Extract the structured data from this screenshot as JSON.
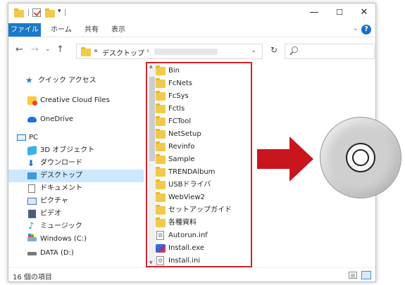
{
  "ribbon": {
    "tabs": [
      "ファイル",
      "ホーム",
      "共有",
      "表示"
    ],
    "help_glyph": "?"
  },
  "address": {
    "prefix": "«",
    "path_segment": "デスクトップ",
    "separator": "›",
    "search_placeholder": ""
  },
  "window_controls": {
    "minimize": "—",
    "maximize": "☐",
    "close": "✕"
  },
  "nav": [
    {
      "label": "クイック アクセス",
      "icon": "star-icon"
    },
    {
      "label": "Creative Cloud Files",
      "icon": "creative-cloud-icon"
    },
    {
      "label": "OneDrive",
      "icon": "cloud-icon"
    },
    {
      "label": "PC",
      "icon": "pc-icon"
    },
    {
      "label": "3D オブジェクト",
      "icon": "cube-icon"
    },
    {
      "label": "ダウンロード",
      "icon": "download-icon"
    },
    {
      "label": "デスクトップ",
      "icon": "desktop-icon",
      "selected": true
    },
    {
      "label": "ドキュメント",
      "icon": "document-icon"
    },
    {
      "label": "ピクチャ",
      "icon": "picture-icon"
    },
    {
      "label": "ビデオ",
      "icon": "video-icon"
    },
    {
      "label": "ミュージック",
      "icon": "music-icon"
    },
    {
      "label": "Windows (C:)",
      "icon": "windows-drive-icon"
    },
    {
      "label": "DATA (D:)",
      "icon": "drive-icon"
    }
  ],
  "files": [
    {
      "name": "Bin",
      "type": "folder"
    },
    {
      "name": "FcNets",
      "type": "folder"
    },
    {
      "name": "FcSys",
      "type": "folder"
    },
    {
      "name": "Fctls",
      "type": "folder"
    },
    {
      "name": "FCTool",
      "type": "folder"
    },
    {
      "name": "NetSetup",
      "type": "folder"
    },
    {
      "name": "Revinfo",
      "type": "folder"
    },
    {
      "name": "Sample",
      "type": "folder"
    },
    {
      "name": "TRENDAlbum",
      "type": "folder"
    },
    {
      "name": "USBドライバ",
      "type": "folder"
    },
    {
      "name": "WebView2",
      "type": "folder"
    },
    {
      "name": "セットアップガイド",
      "type": "folder"
    },
    {
      "name": "各種資料",
      "type": "folder"
    },
    {
      "name": "Autorun.inf",
      "type": "setting"
    },
    {
      "name": "Install.exe",
      "type": "exe"
    },
    {
      "name": "Install.ini",
      "type": "setting"
    }
  ],
  "status": {
    "count_text": "16 個の項目"
  },
  "colors": {
    "accent": "#1979ca",
    "highlight": "#d0242c",
    "arrow": "#c9151e"
  }
}
